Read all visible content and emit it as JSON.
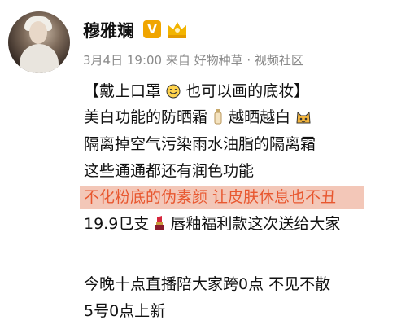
{
  "post": {
    "username": "穆雅斓",
    "verified_badge": "V",
    "meta": "3月4日 19:00 来自 好物种草 · 视频社区",
    "lines": [
      "【戴上口罩",
      "也可以画的底妆】",
      "美白功能的防晒霜",
      " 越晒越白",
      "隔离掉空气污染雨水油脂的隔离霜",
      "这些通通都还有润色功能",
      "不化粉底的伪素颜 让皮肤休息也不丑",
      "19.9㔾支",
      " 唇釉福利款这次送给大家",
      "今晚十点直播陪大家跨0点 不见不散",
      "5号0点上新"
    ],
    "highlight_color": "#e8572f",
    "icons": [
      "avatar",
      "verified-badge",
      "crown-icon",
      "smile-icon",
      "bottle-icon",
      "cat-icon",
      "lipstick-icon"
    ]
  }
}
